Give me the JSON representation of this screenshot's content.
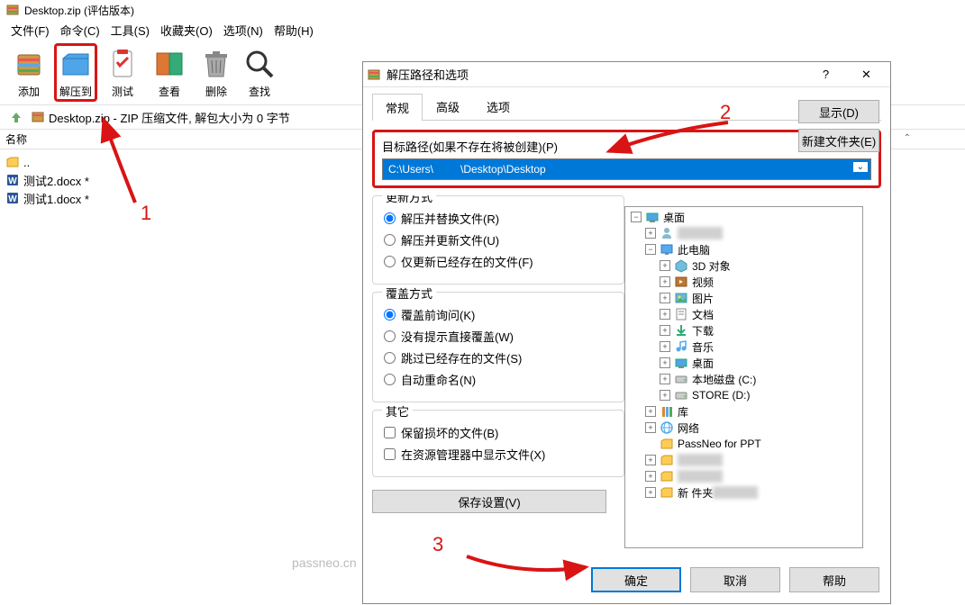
{
  "main": {
    "title": "Desktop.zip (评估版本)",
    "menus": [
      "文件(F)",
      "命令(C)",
      "工具(S)",
      "收藏夹(O)",
      "选项(N)",
      "帮助(H)"
    ],
    "toolbar": [
      {
        "label": "添加",
        "icon": "add"
      },
      {
        "label": "解压到",
        "icon": "extract",
        "highlighted": true
      },
      {
        "label": "测试",
        "icon": "test"
      },
      {
        "label": "查看",
        "icon": "view"
      },
      {
        "label": "删除",
        "icon": "delete"
      },
      {
        "label": "查找",
        "icon": "find"
      }
    ],
    "path_bar": "Desktop.zip - ZIP 压缩文件, 解包大小为 0 字节",
    "list_header": "名称",
    "files": [
      {
        "name": "..",
        "type": "up"
      },
      {
        "name": "测试2.docx *",
        "type": "word"
      },
      {
        "name": "测试1.docx *",
        "type": "word"
      }
    ]
  },
  "dialog": {
    "title": "解压路径和选项",
    "help_btn": "?",
    "close_btn": "✕",
    "tabs": [
      "常规",
      "高级",
      "选项"
    ],
    "target_label": "目标路径(如果不存在将被创建)(P)",
    "target_value": "C:\\Users\\         \\Desktop\\Desktop",
    "display_btn": "显示(D)",
    "new_folder_btn": "新建文件夹(E)",
    "update": {
      "title": "更新方式",
      "options": [
        "解压并替换文件(R)",
        "解压并更新文件(U)",
        "仅更新已经存在的文件(F)"
      ]
    },
    "overwrite": {
      "title": "覆盖方式",
      "options": [
        "覆盖前询问(K)",
        "没有提示直接覆盖(W)",
        "跳过已经存在的文件(S)",
        "自动重命名(N)"
      ]
    },
    "other": {
      "title": "其它",
      "options": [
        "保留损坏的文件(B)",
        "在资源管理器中显示文件(X)"
      ]
    },
    "save_settings": "保存设置(V)",
    "tree": [
      {
        "level": 0,
        "icon": "desktop",
        "label": "桌面",
        "exp": "minus"
      },
      {
        "level": 1,
        "icon": "user",
        "label": "",
        "exp": "plus",
        "blur": true
      },
      {
        "level": 1,
        "icon": "pc",
        "label": "此电脑",
        "exp": "minus"
      },
      {
        "level": 2,
        "icon": "3d",
        "label": "3D 对象",
        "exp": "plus"
      },
      {
        "level": 2,
        "icon": "video",
        "label": "视频",
        "exp": "plus"
      },
      {
        "level": 2,
        "icon": "pic",
        "label": "图片",
        "exp": "plus"
      },
      {
        "level": 2,
        "icon": "doc",
        "label": "文档",
        "exp": "plus"
      },
      {
        "level": 2,
        "icon": "down",
        "label": "下载",
        "exp": "plus"
      },
      {
        "level": 2,
        "icon": "music",
        "label": "音乐",
        "exp": "plus"
      },
      {
        "level": 2,
        "icon": "desktop",
        "label": "桌面",
        "exp": "plus"
      },
      {
        "level": 2,
        "icon": "disk",
        "label": "本地磁盘 (C:)",
        "exp": "plus"
      },
      {
        "level": 2,
        "icon": "disk",
        "label": "STORE (D:)",
        "exp": "plus"
      },
      {
        "level": 1,
        "icon": "lib",
        "label": "库",
        "exp": "plus"
      },
      {
        "level": 1,
        "icon": "net",
        "label": "网络",
        "exp": "plus"
      },
      {
        "level": 1,
        "icon": "folder",
        "label": "PassNeo for PPT",
        "exp": "none"
      },
      {
        "level": 1,
        "icon": "folder",
        "label": "",
        "exp": "plus",
        "blur": true
      },
      {
        "level": 1,
        "icon": "folder",
        "label": "",
        "exp": "plus",
        "blur": true
      },
      {
        "level": 1,
        "icon": "folder",
        "label": "新     件夹",
        "exp": "plus",
        "blur": true
      }
    ],
    "footer": {
      "ok": "确定",
      "cancel": "取消",
      "help": "帮助"
    }
  },
  "annotations": {
    "n1": "1",
    "n2": "2",
    "n3": "3"
  },
  "watermark": "passneo.cn"
}
